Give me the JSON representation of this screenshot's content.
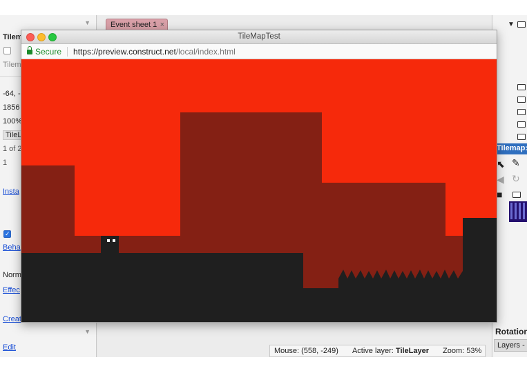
{
  "editor": {
    "left_panel": {
      "section_label": "Tilem",
      "type_label": "Tilem",
      "position_value": "-64, -",
      "size_value": "1856",
      "scale_value": "100%",
      "layer_value": "TileL",
      "count_value": "1 of 2",
      "index_value": "1",
      "instance_link": "Insta",
      "behaviors_link": "Beha",
      "blend_value": "Norm",
      "effects_link": "Effec",
      "create_link": "Creat",
      "edit_link": "Edit"
    },
    "tab": {
      "label": "Event sheet 1",
      "close_glyph": "×"
    },
    "status": {
      "mouse": "Mouse: (558, -249)",
      "active_layer_label": "Active layer:",
      "active_layer_value": "TileLayer",
      "zoom": "Zoom: 53%"
    },
    "right_panel": {
      "tilemap_header": "Tilemap: T",
      "rotation_label": "Rotation",
      "layers_tab": "Layers -"
    }
  },
  "browser": {
    "title": "TileMapTest",
    "secure_label": "Secure",
    "url_host": "https://preview.construct.net",
    "url_path": "/local/index.html"
  },
  "game": {
    "colors": {
      "sky": "#f6290b",
      "wall": "#842014",
      "ground": "#1f1f1f",
      "player_eyes": "#ffffff"
    }
  },
  "icons": {
    "dropdown": "chevron-down-icon",
    "folder": "folder-icon",
    "pencil": "pencil-icon",
    "pointer": "pointer-icon",
    "rotate": "rotate-icon",
    "save": "save-icon",
    "lock": "lock-icon"
  }
}
